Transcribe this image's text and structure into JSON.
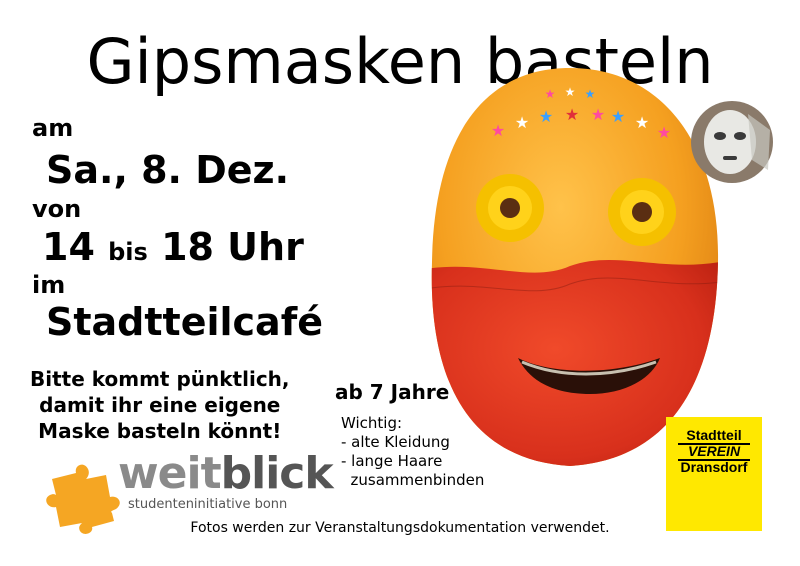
{
  "title": "Gipsmasken basteln",
  "schedule": {
    "am_label": "am",
    "date": "Sa., 8. Dez.",
    "von_label": "von",
    "time_start": "14",
    "time_bis": "bis",
    "time_end": "18 Uhr",
    "im_label": "im",
    "venue": "Stadtteilcafé"
  },
  "note_lines": [
    "Bitte kommt pünktlich,",
    "damit ihr eine eigene",
    "Maske basteln könnt!"
  ],
  "age": "ab 7 Jahre",
  "important": {
    "heading": "Wichtig:",
    "items": [
      "- alte Kleidung",
      "- lange Haare",
      "  zusammenbinden"
    ]
  },
  "photo_note": "Fotos werden zur Veranstaltungsdokumentation verwendet.",
  "logo": {
    "word_part1": "weit",
    "word_part2": "blick",
    "subtitle": "studenteninitiative bonn",
    "puzzle_color": "#f5a623"
  },
  "verein_badge": {
    "line1": "Stadtteil",
    "line2": "VEREIN",
    "line3": "Dransdorf",
    "background": "#ffe800"
  },
  "images": {
    "main_mask": "painted-plaster-mask",
    "small_mask": "white-plaster-mask-photo"
  }
}
